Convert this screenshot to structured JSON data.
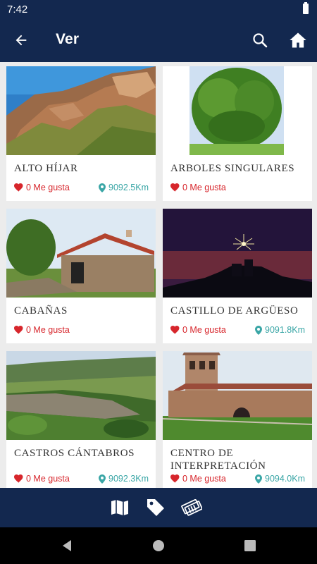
{
  "status_bar": {
    "time": "7:42"
  },
  "app_bar": {
    "title": "Ver"
  },
  "places": [
    {
      "title": "ALTO HÍJAR",
      "likes": "0 Me gusta",
      "distance": "9092.5Km"
    },
    {
      "title": "ARBOLES SINGULARES",
      "likes": "0 Me gusta",
      "distance": ""
    },
    {
      "title": "CABAÑAS",
      "likes": "0 Me gusta",
      "distance": ""
    },
    {
      "title": "CASTILLO DE ARGÜESO",
      "likes": "0 Me gusta",
      "distance": "9091.8Km"
    },
    {
      "title": "CASTROS CÁNTABROS",
      "likes": "0 Me gusta",
      "distance": "9092.3Km"
    },
    {
      "title": "CENTRO DE INTERPRETACIÓN",
      "likes": "0 Me gusta",
      "distance": "9094.0Km"
    }
  ],
  "icons": {
    "back": "arrow-back-icon",
    "search": "search-icon",
    "home": "home-icon",
    "like": "heart-icon",
    "distance": "location-pin-icon",
    "nav_map": "map-icon",
    "nav_tag": "tag-icon",
    "nav_tickets": "tickets-icon"
  },
  "colors": {
    "primary": "#13284f",
    "like": "#d7262c",
    "distance": "#3aa6a6",
    "background": "#ececec"
  }
}
